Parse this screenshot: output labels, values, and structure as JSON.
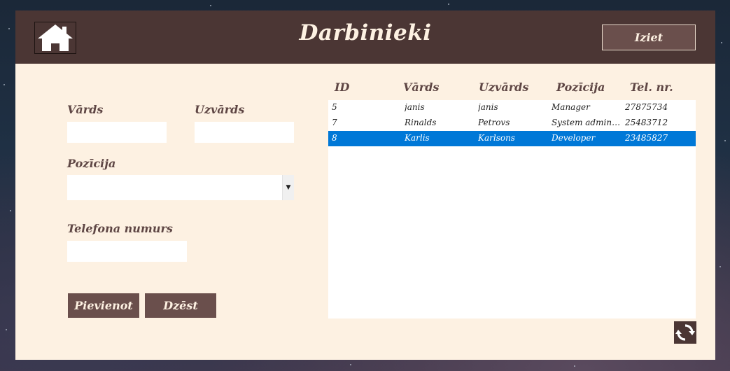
{
  "window": {
    "title": "Darbinieki",
    "exit_label": "Iziet"
  },
  "form": {
    "first_name_label": "Vārds",
    "first_name_value": "",
    "last_name_label": "Uzvārds",
    "last_name_value": "",
    "position_label": "Pozīcija",
    "position_value": "",
    "phone_label": "Telefona numurs",
    "phone_value": "",
    "add_label": "Pievienot",
    "delete_label": "Dzēst"
  },
  "table": {
    "columns": [
      "ID",
      "Vārds",
      "Uzvārds",
      "Pozīcija",
      "Tel. nr."
    ],
    "rows": [
      [
        "5",
        "janis",
        "janis",
        "Manager",
        "27875734"
      ],
      [
        "7",
        "Rinalds",
        "Petrovs",
        "System adminis...",
        "25483712"
      ],
      [
        "8",
        "Karlis",
        "Karlsons",
        "Developer",
        "23485827"
      ]
    ],
    "selected_row": 2
  },
  "icons": {
    "home": "home-icon",
    "dropdown": "caret-down-icon",
    "refresh": "refresh-icon"
  },
  "colors": {
    "header": "#4b3634",
    "panel": "#fdf1e2",
    "button": "#6a4f4c",
    "selection": "#0078d7"
  }
}
